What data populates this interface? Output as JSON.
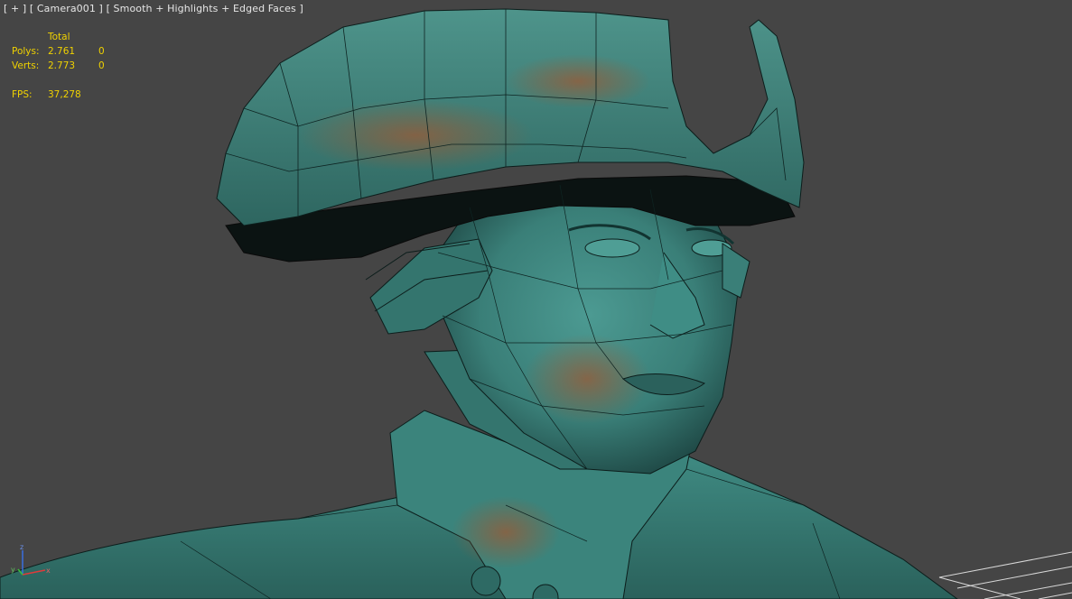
{
  "viewport": {
    "label_plus": "[ + ]",
    "label_camera": "[ Camera001 ]",
    "label_shading": "[ Smooth + Highlights + Edged Faces ]"
  },
  "stats": {
    "header_total": "Total",
    "polys_label": "Polys:",
    "polys_total": "2.761",
    "polys_selected": "0",
    "verts_label": "Verts:",
    "verts_total": "2.773",
    "verts_selected": "0",
    "fps_label": "FPS:",
    "fps_value": "37,278"
  },
  "gizmo": {
    "z_label": "z",
    "x_label": "x",
    "y_label": "y"
  },
  "colors": {
    "background": "#454545",
    "stats_text": "#f0d200",
    "model_base": "#3e8a82",
    "model_rust": "#8a5a3a",
    "wire": "#000000"
  },
  "icons": [
    "axis-gizmo-icon"
  ]
}
